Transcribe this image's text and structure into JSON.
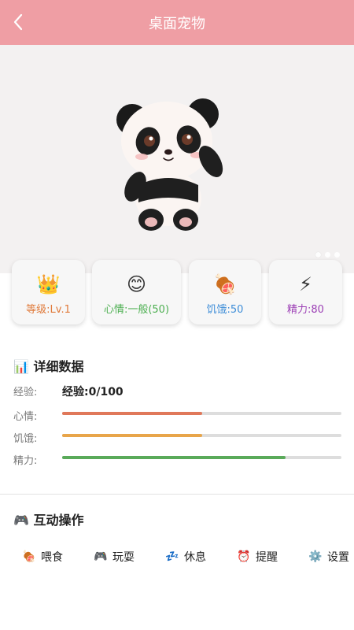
{
  "header": {
    "title": "桌面宠物"
  },
  "hero": {
    "pet_icon": "panda-image",
    "dots": 3,
    "active_dot": 0
  },
  "stats": [
    {
      "icon": "👑",
      "icon_name": "crown-icon",
      "label": "等级:Lv.1",
      "color": "#e07a3a"
    },
    {
      "icon": "😊",
      "icon_name": "smile-icon",
      "label": "心情:一般(50)",
      "color": "#4caf50"
    },
    {
      "icon": "🍖",
      "icon_name": "meat-icon",
      "label": "饥饿:50",
      "color": "#3f8ed8"
    },
    {
      "icon": "⚡",
      "icon_name": "lightning-icon",
      "label": "精力:80",
      "color": "#9c3fb5"
    }
  ],
  "details": {
    "title": "📊 详细数据",
    "exp_label": "经验:",
    "exp_value": "经验:0/100",
    "mood_label": "心情:",
    "hunger_label": "饥饿:",
    "energy_label": "精力:",
    "mood_level": 0.5,
    "hunger_level": 0.5,
    "energy_level": 0.8,
    "mood_color": "#e0785a",
    "hunger_color": "#e8a54a",
    "energy_color": "#5aaa5a"
  },
  "actions": {
    "title": "🎮 互动操作",
    "items": [
      {
        "icon": "🍖",
        "icon_name": "meat-icon",
        "label": "喂食"
      },
      {
        "icon": "🎮",
        "icon_name": "gamepad-icon",
        "label": "玩耍"
      },
      {
        "icon": "💤",
        "icon_name": "sleep-icon",
        "label": "休息"
      },
      {
        "icon": "⏰",
        "icon_name": "alarm-clock-icon",
        "label": "提醒"
      },
      {
        "icon": "⚙️",
        "icon_name": "gear-icon",
        "label": "设置"
      }
    ]
  }
}
